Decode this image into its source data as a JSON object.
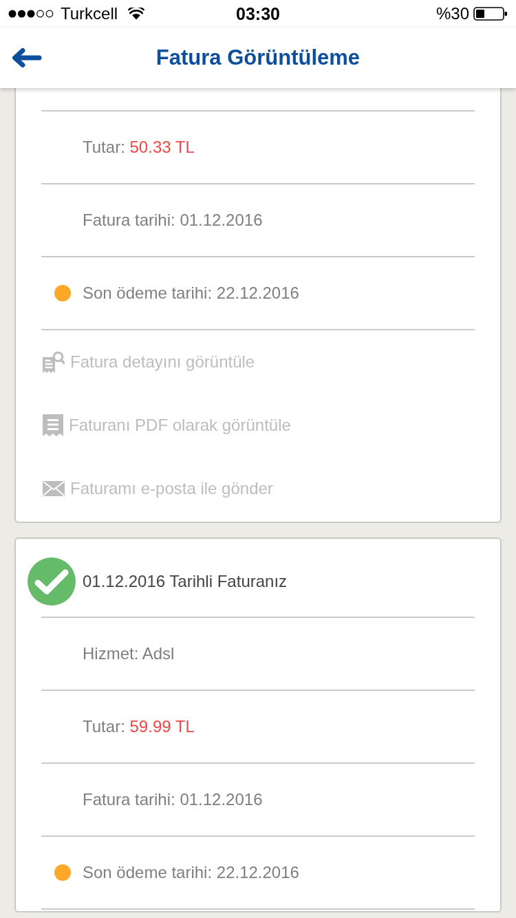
{
  "status_bar": {
    "carrier": "Turkcell",
    "time": "03:30",
    "battery": "%30"
  },
  "nav": {
    "title": "Fatura Görüntüleme"
  },
  "invoices": [
    {
      "rows": [
        {
          "kind": "amount",
          "label": "Tutar:",
          "value": "50.33 TL"
        },
        {
          "kind": "text",
          "text": "Fatura tarihi: 01.12.2016"
        },
        {
          "kind": "due",
          "text": "Son ödeme tarihi: 22.12.2016",
          "color": "#ffa726"
        }
      ],
      "actions": [
        {
          "kind": "detail",
          "label": "Fatura detayını görüntüle",
          "disabled": true
        },
        {
          "kind": "pdf",
          "label": "Faturanı PDF olarak görüntüle",
          "disabled": true
        },
        {
          "kind": "email",
          "label": "Faturamı e-posta ile gönder",
          "disabled": true
        }
      ]
    },
    {
      "header": {
        "title": "01.12.2016 Tarihli Faturanız",
        "paid": true
      },
      "rows": [
        {
          "kind": "text",
          "text": "Hizmet: Adsl"
        },
        {
          "kind": "amount",
          "label": "Tutar:",
          "value": "59.99 TL"
        },
        {
          "kind": "text",
          "text": "Fatura tarihi: 01.12.2016"
        },
        {
          "kind": "due",
          "text": "Son ödeme tarihi: 22.12.2016",
          "color": "#ffa726"
        }
      ]
    }
  ]
}
